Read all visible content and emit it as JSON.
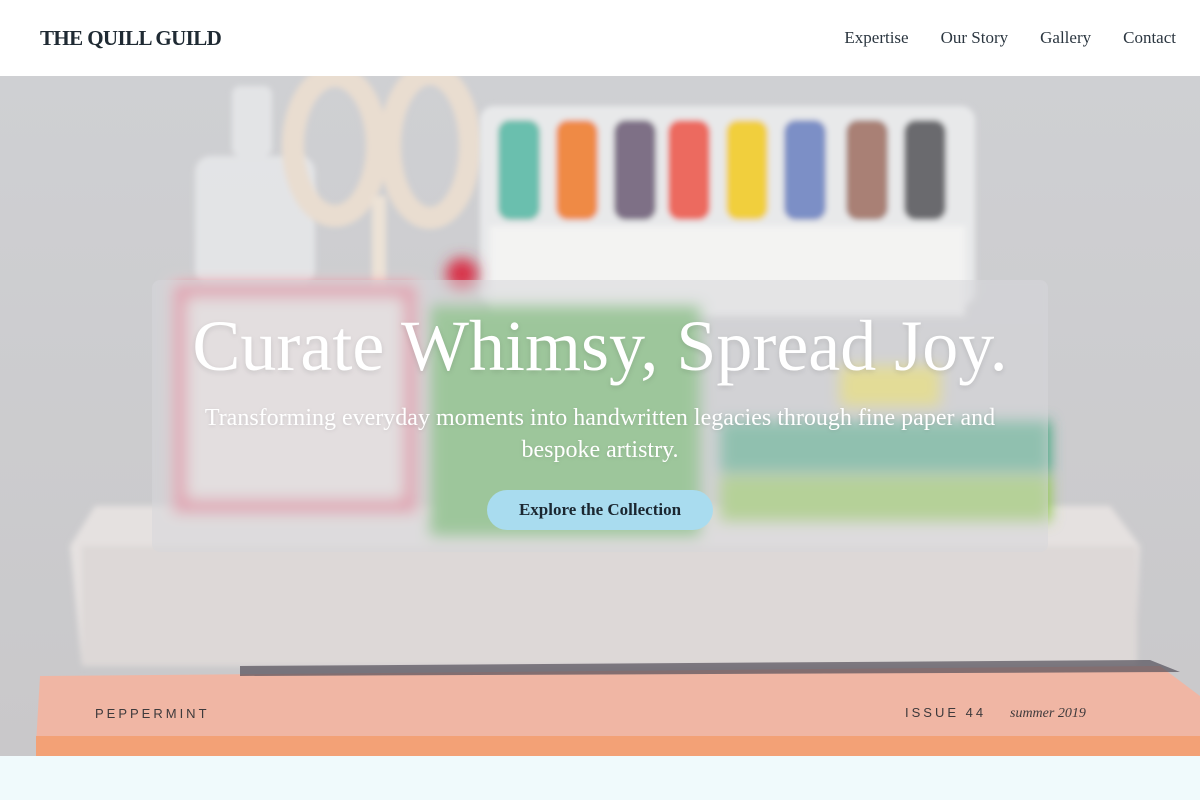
{
  "header": {
    "brand": "THE QUILL GUILD",
    "nav": [
      {
        "label": "Expertise"
      },
      {
        "label": "Our Story"
      },
      {
        "label": "Gallery"
      },
      {
        "label": "Contact"
      }
    ]
  },
  "hero": {
    "headline": "Curate Whimsy, Spread Joy.",
    "tagline": "Transforming everyday moments into handwritten legacies through fine paper and bespoke artistry.",
    "cta_label": "Explore the Collection",
    "image": {
      "book_text_left": "PEPPERMINT",
      "book_text_right": "ISSUE 44",
      "book_text_script": "summer 2019"
    }
  },
  "colors": {
    "header_bg": "#ffffff",
    "cta_bg": "#a9dcef",
    "page_bg": "#f0fafc",
    "overlay": "rgba(215,215,218,0.55)"
  }
}
